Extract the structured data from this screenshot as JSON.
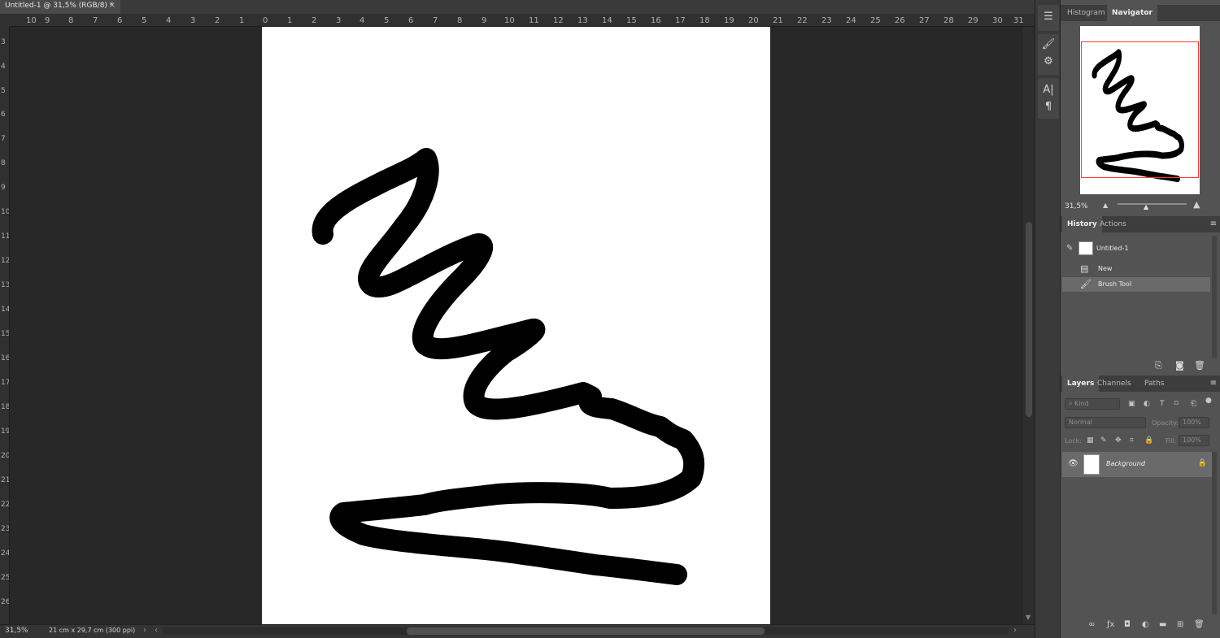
{
  "document": {
    "tab_title": "Untitled-1 @ 31,5% (RGB/8) *",
    "close_glyph": "×"
  },
  "rulers": {
    "top": [
      "10",
      "9",
      "8",
      "7",
      "6",
      "5",
      "4",
      "3",
      "2",
      "1",
      "0",
      "1",
      "2",
      "3",
      "4",
      "5",
      "6",
      "7",
      "8",
      "9",
      "10",
      "11",
      "12",
      "13",
      "14",
      "15",
      "16",
      "17",
      "18",
      "19",
      "20",
      "21",
      "22",
      "23",
      "24",
      "25",
      "26",
      "27",
      "28",
      "29",
      "30",
      "31"
    ],
    "left": [
      "3",
      "4",
      "5",
      "6",
      "7",
      "8",
      "9",
      "10",
      "11",
      "12",
      "13",
      "14",
      "15",
      "16",
      "17",
      "18",
      "19",
      "20",
      "21",
      "22",
      "23",
      "24",
      "25",
      "26"
    ]
  },
  "status": {
    "zoom": "31,5%",
    "doc_info": "21 cm x 29,7 cm (300 ppi)",
    "arrow_right": "›",
    "arrow_left": "‹"
  },
  "panels": {
    "navigator": {
      "tabs": [
        "Histogram",
        "Navigator"
      ],
      "active_tab": "Navigator",
      "zoom": "31,5%"
    },
    "history": {
      "tabs": [
        "History",
        "Actions"
      ],
      "active_tab": "History",
      "snapshot": "Untitled-1",
      "items": [
        "New",
        "Brush Tool"
      ],
      "selected": "Brush Tool"
    },
    "layers": {
      "tabs": [
        "Layers",
        "Channels",
        "Paths"
      ],
      "active_tab": "Layers",
      "filter_placeholder": "Kind",
      "blend_mode": "Normal",
      "opacity_label": "Opacity:",
      "opacity_value": "100%",
      "lock_label": "Lock:",
      "fill_label": "Fill:",
      "fill_value": "100%",
      "layer_name": "Background"
    }
  },
  "colors": {
    "workspace": "#282828",
    "panel_bg": "#535353",
    "stroke": "#000000",
    "navigator_frame": "#ff3a3a"
  }
}
